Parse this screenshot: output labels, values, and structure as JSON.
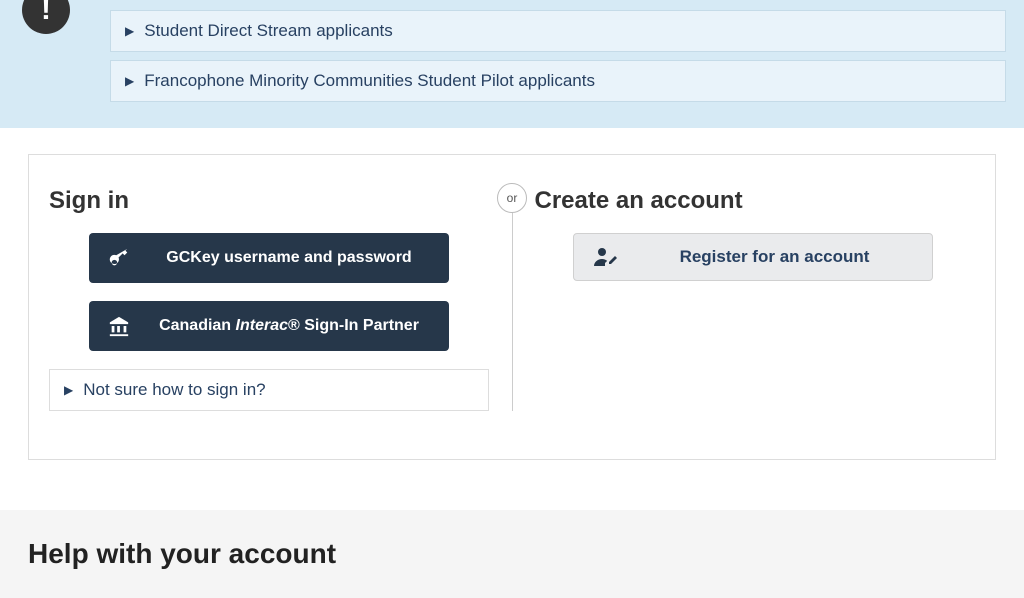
{
  "notice": {
    "expanders": [
      {
        "label": "Student Direct Stream applicants"
      },
      {
        "label": "Francophone Minority Communities Student Pilot applicants"
      }
    ]
  },
  "signin": {
    "title": "Sign in",
    "gckey_label": "GCKey username and password",
    "interac_prefix": "Canadian ",
    "interac_name": "Interac",
    "interac_suffix": "® Sign-In Partner",
    "not_sure_label": "Not sure how to sign in?"
  },
  "divider": {
    "or_label": "or"
  },
  "create": {
    "title": "Create an account",
    "register_label": "Register for an account"
  },
  "help": {
    "title": "Help with your account"
  }
}
